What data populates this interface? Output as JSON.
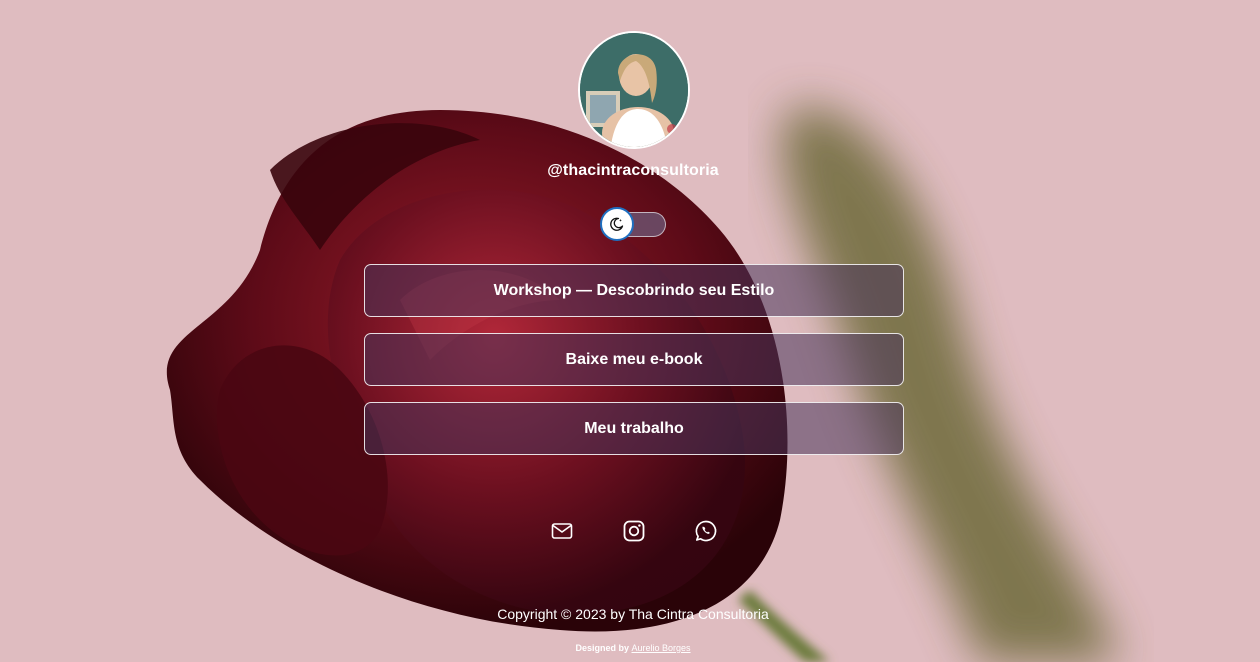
{
  "profile": {
    "handle": "@thacintraconsultoria"
  },
  "theme_toggle": {
    "icon": "moon-icon",
    "state": "off"
  },
  "links": [
    {
      "label": "Workshop — Descobrindo seu Estilo"
    },
    {
      "label": "Baixe meu e-book"
    },
    {
      "label": "Meu trabalho"
    }
  ],
  "social": [
    {
      "icon": "mail-icon"
    },
    {
      "icon": "instagram-icon"
    },
    {
      "icon": "whatsapp-icon"
    }
  ],
  "footer": {
    "copyright": "Copyright © 2023 by Tha Cintra Consultoria",
    "designed_prefix": "Designed by",
    "designer_name": "Aurelio Borges"
  },
  "colors": {
    "background": "#dfbcc0",
    "button_bg": "#48345a",
    "toggle_border": "#1f6fc0",
    "text": "#ffffff"
  }
}
